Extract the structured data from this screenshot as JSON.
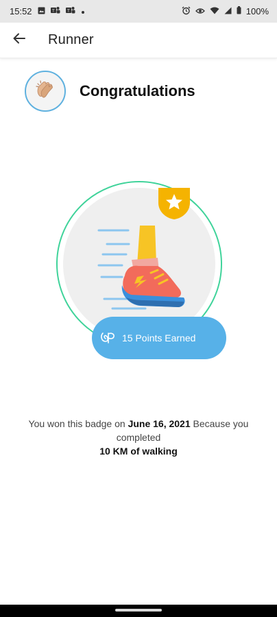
{
  "status_bar": {
    "time": "15:52",
    "battery": "100%",
    "icons": [
      "image-icon",
      "teams-icon",
      "teams-icon",
      "dot-icon",
      "alarm-icon",
      "eye-icon",
      "wifi-icon",
      "signal-icon",
      "battery-icon"
    ]
  },
  "app_bar": {
    "title": "Runner",
    "back_icon": "arrow-left-icon"
  },
  "header": {
    "title": "Congratulations",
    "avatar_icon": "clapping-hands-icon"
  },
  "badge": {
    "art": "running-shoe-icon",
    "corner_icon": "star-icon",
    "points_text": "15 Points Earned",
    "points_icon": "points-logo-icon",
    "colors": {
      "ring": "#3fd39a",
      "pill": "#57b1e8",
      "star": "#f5b301"
    }
  },
  "message": {
    "part1": "You won this badge on ",
    "date": "June 16, 2021",
    "part2": " Because you completed ",
    "achievement": "10 KM of walking"
  }
}
